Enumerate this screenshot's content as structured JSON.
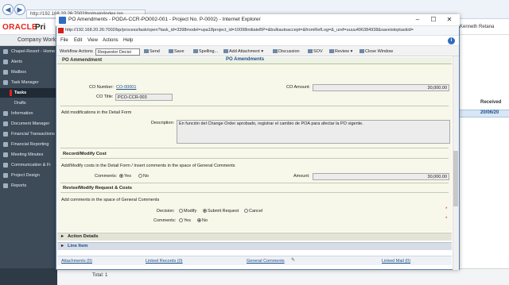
{
  "background": {
    "address": "http://192.168.20.26:7002/bp/main/index.jsp",
    "oracle_logo": "ORACLE",
    "app_short": "Pri",
    "user_name": "Kenneth Retana",
    "company_tab": "Company Work",
    "sidebar": [
      {
        "label": "Chapel-Resort - Home"
      },
      {
        "label": "Alerts"
      },
      {
        "label": "Mailbox"
      },
      {
        "label": "Task Manager"
      },
      {
        "label": "Tasks"
      },
      {
        "label": "Drafts"
      },
      {
        "label": "Information"
      },
      {
        "label": "Document Manager"
      },
      {
        "label": "Financial Transactions"
      },
      {
        "label": "Financial Reporting"
      },
      {
        "label": "Meeting Minutes"
      },
      {
        "label": "Communication & Fi"
      },
      {
        "label": "Project Design"
      },
      {
        "label": "Reports"
      }
    ],
    "received_header": "Received",
    "received_value": "20/06/20",
    "total": "Total: 1"
  },
  "popup": {
    "title": "PO Amendments - PODA-CCR-PO002-001 - Project No. P-0002) - Internet Explorer",
    "url": "http://192.168.20.26:7002/bp/process/task/open?task_id=3398model=upa18project_id=10098initiateBP=&bulkautoaccept=&fromRefLog=&_uref=uuuu496384938&saveisteptaskid=",
    "minimize": "–",
    "maximize": "☐",
    "close": "✕",
    "menu": [
      "File",
      "Edit",
      "View",
      "Actions",
      "Help"
    ],
    "toolbar": {
      "workflow_label": "Workflow Actions",
      "workflow_select": "Requestor Decisi",
      "send": "Send",
      "save": "Save",
      "spelling": "Spelling...",
      "add_attachment": "Add Attachment",
      "discussion": "Discussion",
      "sov": "SOV",
      "review": "Review",
      "close_window": "Close Window"
    },
    "section_bar_left": "PO Ammendment",
    "section_bar_center": "PO Amendments",
    "co_number_label": "CO Number:",
    "co_number_value": "CO-00001",
    "co_title_label": "CO Title:",
    "co_title_value": "PCO-CCR-003",
    "co_amount_label": "CO Amount:",
    "co_amount_value": "30,000.00",
    "modifications_note": "Add modifications in the Detail Form",
    "description_label": "Description:",
    "description_value": "En función del Change Order aprobado, registrar el cambio de POA para afectar la PO vigente.",
    "record_cost_head": "Record/Modify Cost",
    "record_cost_note": "Add/Modify costs in the Detail Form / Insert comments in the space of General Comments",
    "comments_label": "Comments:",
    "yes": "Yes",
    "no": "No",
    "amount_label": "Amount:",
    "amount_value": "30,000.00",
    "revise_head": "Revise/Modify Request & Costs",
    "revise_note": "Add comments in the space of General Comments",
    "decision_label": "Decision:",
    "decision_options": [
      "Modify",
      "Submit Request",
      "Cancel"
    ],
    "decision_selected": "Submit Request",
    "comments2_label": "Comments:",
    "comments2_selected": "No",
    "action_details": "Action Details",
    "line_item": "Line Item",
    "footer": {
      "attachments": "Attachments (0)",
      "linked_records": "Linked Records (0)",
      "general_comments": "General Comments",
      "linked_mail": "Linked Mail (0)"
    }
  }
}
